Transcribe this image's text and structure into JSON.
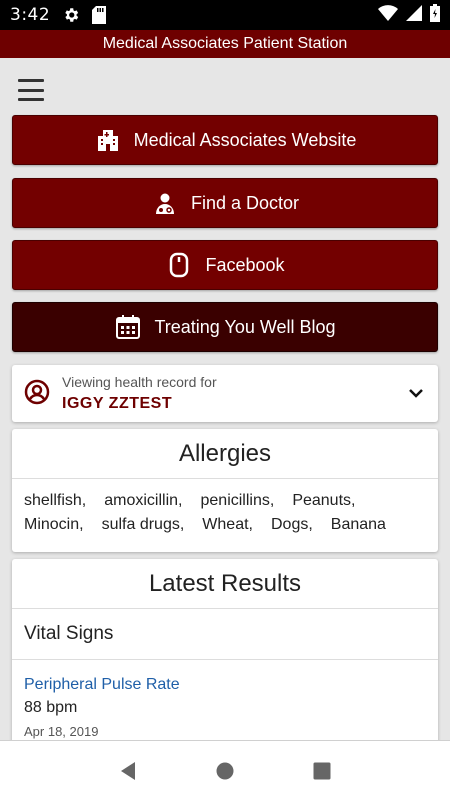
{
  "status_bar": {
    "time": "3:42",
    "icons": [
      "gear-icon",
      "sd-card-icon",
      "wifi-icon",
      "signal-icon",
      "battery-icon"
    ]
  },
  "app": {
    "title": "Medical Associates Patient Station",
    "brand_color": "#730000",
    "dark_brand_color": "#3a0000"
  },
  "menu": {
    "icon": "hamburger-menu-icon"
  },
  "links": [
    {
      "label": "Medical Associates Website",
      "icon": "hospital-building-icon"
    },
    {
      "label": "Find a Doctor",
      "icon": "doctor-icon"
    },
    {
      "label": "Facebook",
      "icon": "mouse-icon"
    },
    {
      "label": "Treating You Well Blog",
      "icon": "calendar-icon"
    }
  ],
  "health_record": {
    "caption": "Viewing health record for",
    "patient_name": "IGGY ZZTEST",
    "icon": "user-circle-icon",
    "toggle_icon": "chevron-down-icon"
  },
  "allergies": {
    "title": "Allergies",
    "items": [
      "shellfish,",
      "amoxicillin,",
      "penicillins,",
      "Peanuts,",
      "Minocin,",
      "sulfa drugs,",
      "Wheat,",
      "Dogs,",
      "Banana"
    ]
  },
  "latest_results": {
    "title": "Latest Results",
    "section": "Vital Signs",
    "items": [
      {
        "name": "Peripheral Pulse Rate",
        "value": "88 bpm",
        "date": "Apr 18, 2019"
      }
    ]
  },
  "navigation": {
    "back_icon": "back-triangle-icon",
    "home_icon": "home-circle-icon",
    "recents_icon": "recents-square-icon"
  }
}
